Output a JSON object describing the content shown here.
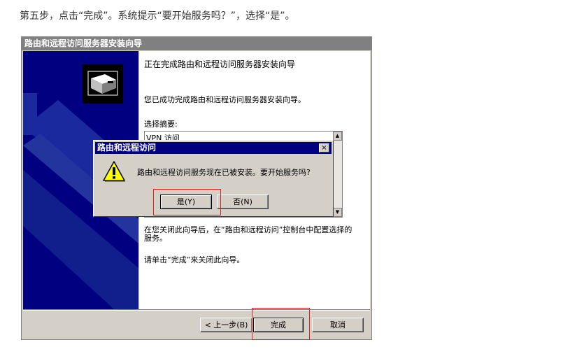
{
  "caption": "第五步，点击“完成”。系统提示“要开始服务吗？”，选择“是”。",
  "wizard": {
    "title": "路由和远程访问服务器安装向导",
    "heading": "正在完成路由和远程访问服务器安装向导",
    "done_text": "您已成功完成路由和远程访问服务器安装向导。",
    "summary_label": "选择摘要:",
    "summary_items": [
      "VPN 访问"
    ],
    "after_text": "在您关闭此向导后，在“路由和远程访问”控制台中配置选择的服务。",
    "click_text": "请单击“完成”来关闭此向导。",
    "back_button": "< 上一步(B)",
    "finish_button": "完成",
    "cancel_button": "取消"
  },
  "dialog": {
    "title": "路由和远程访问",
    "close_glyph": "×",
    "message": "路由和远程访问服务现在已被安装。要开始服务吗?",
    "yes_button": "是(Y)",
    "no_button": "否(N)"
  },
  "colors": {
    "side_panel": "#000080",
    "dialog_title_bar": "#000080",
    "highlight": "#e02020"
  },
  "icons": [
    "wizard-computer-icon",
    "warning-icon",
    "close-icon",
    "scroll-up-icon",
    "scroll-down-icon"
  ]
}
